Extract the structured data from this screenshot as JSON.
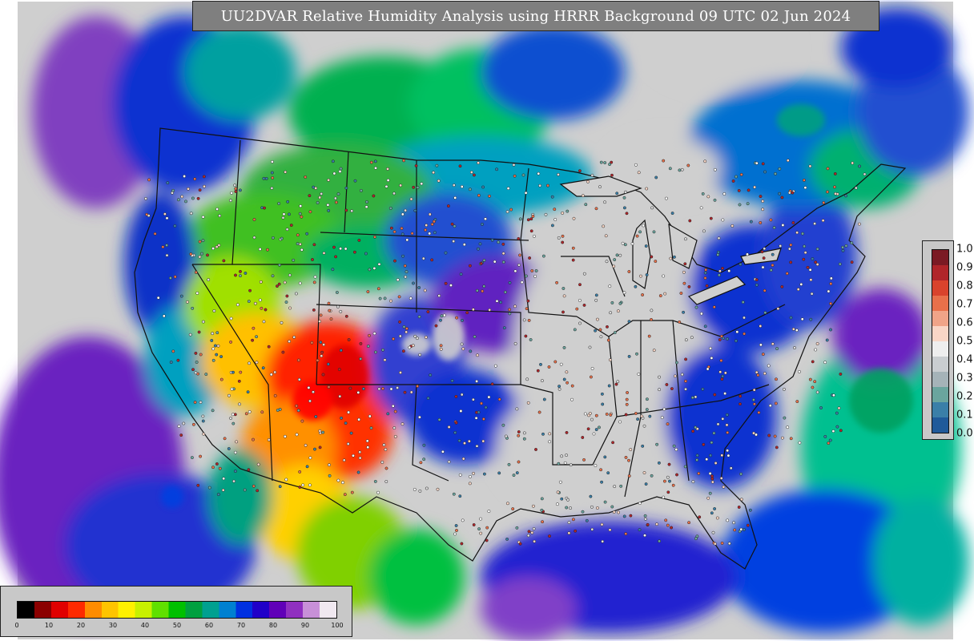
{
  "title": "UU2DVAR Relative Humidity Analysis using HRRR Background 09 UTC 02 Jun 2024",
  "right_legend": {
    "labels": [
      "1.0",
      "0.9",
      "0.8",
      "0.7",
      "0.6",
      "0.5",
      "0.4",
      "0.3",
      "0.2",
      "0.1",
      "0.0"
    ],
    "colors": [
      "#7b1a24",
      "#b0252a",
      "#d9432c",
      "#e8704a",
      "#f0a488",
      "#f9d6c6",
      "#eeeeee",
      "#c9cdd0",
      "#a5b3b8",
      "#6aa59e",
      "#3a7fa8",
      "#1f5a9a"
    ]
  },
  "bottom_legend": {
    "ticks": [
      "0",
      "10",
      "20",
      "30",
      "40",
      "50",
      "60",
      "70",
      "80",
      "90",
      "100"
    ],
    "colors": [
      "#000000",
      "#8b0000",
      "#e00000",
      "#ff2a00",
      "#ff8c00",
      "#ffc400",
      "#fff000",
      "#c8f000",
      "#60e000",
      "#00c000",
      "#00a040",
      "#00a090",
      "#0080d0",
      "#0030e0",
      "#2000c8",
      "#6000b8",
      "#9030c0",
      "#c890d8",
      "#f0e8f0"
    ]
  }
}
